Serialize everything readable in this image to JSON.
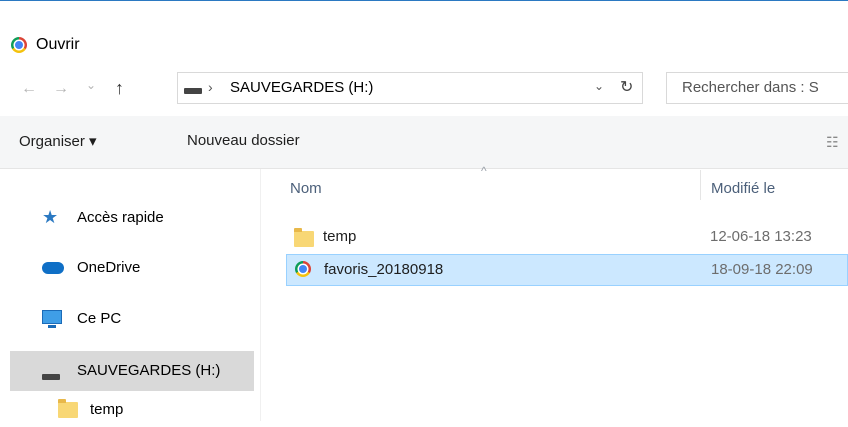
{
  "window": {
    "title": "Ouvrir",
    "app_icon": "chrome-icon"
  },
  "nav": {
    "back_icon": "←",
    "forward_icon": "→",
    "dropdown_icon": "⌄",
    "up_icon": "↑"
  },
  "address": {
    "separator": "›",
    "path": "SAUVEGARDES (H:)",
    "dropdown_glyph": "⌄",
    "refresh_glyph": "↻"
  },
  "search": {
    "placeholder": "Rechercher dans : S"
  },
  "toolbar": {
    "organise_label": "Organiser ▾",
    "new_folder_label": "Nouveau dossier",
    "view_glyph": "☷"
  },
  "nav_pane": {
    "items": [
      {
        "label": "Accès rapide",
        "icon": "star-icon"
      },
      {
        "label": "OneDrive",
        "icon": "cloud-icon"
      },
      {
        "label": "Ce PC",
        "icon": "computer-icon"
      },
      {
        "label": "SAUVEGARDES (H:)",
        "icon": "drive-icon"
      },
      {
        "label": "temp",
        "icon": "folder-icon"
      }
    ]
  },
  "file_list": {
    "sort_glyph": "^",
    "columns": [
      "Nom",
      "Modifié le"
    ],
    "rows": [
      {
        "name": "temp",
        "modified": "12-06-18 13:23",
        "icon": "folder-icon"
      },
      {
        "name": "favoris_20180918",
        "modified": "18-09-18 22:09",
        "icon": "chrome-icon",
        "selected": true
      }
    ]
  },
  "colors": {
    "accent": "#2b79c2",
    "selection_bg": "#cce8ff",
    "selection_border": "#99d1ff",
    "nav_selected": "#d9d9d9"
  }
}
